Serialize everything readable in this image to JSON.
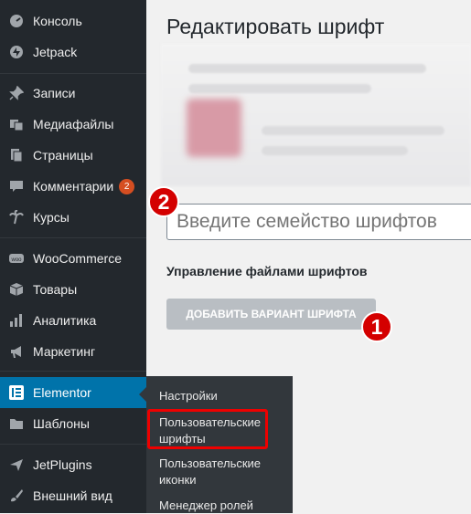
{
  "sidebar": {
    "items": [
      {
        "label": "Консоль",
        "icon": "dashboard-icon"
      },
      {
        "label": "Jetpack",
        "icon": "jetpack-icon"
      },
      {
        "label": "Записи",
        "icon": "pin-icon"
      },
      {
        "label": "Медиафайлы",
        "icon": "media-icon"
      },
      {
        "label": "Страницы",
        "icon": "pages-icon"
      },
      {
        "label": "Комментарии",
        "icon": "comment-icon",
        "badge": "2"
      },
      {
        "label": "Курсы",
        "icon": "palm-icon"
      },
      {
        "label": "WooCommerce",
        "icon": "woo-icon"
      },
      {
        "label": "Товары",
        "icon": "box-icon"
      },
      {
        "label": "Аналитика",
        "icon": "bar-chart-icon"
      },
      {
        "label": "Маркетинг",
        "icon": "megaphone-icon"
      },
      {
        "label": "Elementor",
        "icon": "elementor-icon"
      },
      {
        "label": "Шаблоны",
        "icon": "folder-icon"
      },
      {
        "label": "JetPlugins",
        "icon": "jetplugins-icon"
      },
      {
        "label": "Внешний вид",
        "icon": "brush-icon"
      }
    ]
  },
  "submenu": {
    "items": [
      "Настройки",
      "Пользовательские шрифты",
      "Пользовательские иконки",
      "Менеджер ролей"
    ]
  },
  "main": {
    "title": "Редактировать шрифт",
    "family_placeholder": "Введите семейство шрифтов",
    "section_label": "Управление файлами шрифтов",
    "add_button": "ДОБАВИТЬ ВАРИАНТ ШРИФТА"
  },
  "annotations": {
    "step1": "1",
    "step2": "2"
  },
  "colors": {
    "sidebar_bg": "#23282d",
    "active_bg": "#0073aa",
    "submenu_bg": "#32373c",
    "highlight": "#e00000",
    "badge": "#d54e21"
  }
}
